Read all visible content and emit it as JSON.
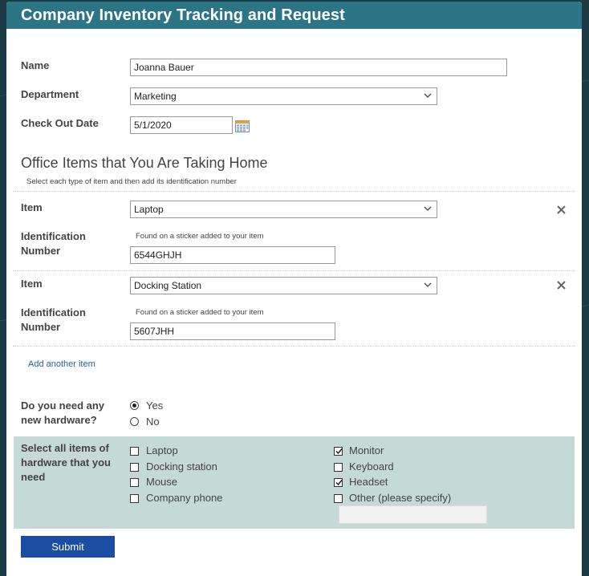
{
  "form": {
    "title": "Company Inventory Tracking and Request",
    "name_label": "Name",
    "name_value": "Joanna Bauer",
    "department_label": "Department",
    "department_value": "Marketing",
    "checkout_label": "Check Out Date",
    "checkout_value": "5/1/2020",
    "items_section_title": "Office Items that You Are Taking Home",
    "items_section_hint": "Select each type of item and then add its identification number",
    "items": [
      {
        "item_label": "Item",
        "item_value": "Laptop",
        "id_label": "Identification Number",
        "id_hint": "Found on a sticker added to your item",
        "id_value": "6544GHJH"
      },
      {
        "item_label": "Item",
        "item_value": "Docking Station",
        "id_label": "Identification Number",
        "id_hint": "Found on a sticker added to your item",
        "id_value": "5607JHH"
      }
    ],
    "add_item_link": "Add another item",
    "need_hw_label": "Do you need any new hardware?",
    "need_hw_options": [
      {
        "label": "Yes",
        "selected": true
      },
      {
        "label": "No",
        "selected": false
      }
    ],
    "hw_label": "Select all items of hardware that you need",
    "hw_left": [
      {
        "label": "Laptop",
        "checked": false
      },
      {
        "label": "Docking station",
        "checked": false
      },
      {
        "label": "Mouse",
        "checked": false
      },
      {
        "label": "Company phone",
        "checked": false
      }
    ],
    "hw_right": [
      {
        "label": "Monitor",
        "checked": true
      },
      {
        "label": "Keyboard",
        "checked": false
      },
      {
        "label": "Headset",
        "checked": true
      },
      {
        "label": "Other (please specify)",
        "checked": false
      }
    ],
    "other_value": "",
    "submit_label": "Submit"
  },
  "colors": {
    "header": "#2b7585",
    "panel": "#c5d9d6",
    "submit": "#1b4ea3",
    "link": "#2064a8",
    "background": "#1b3a44"
  }
}
